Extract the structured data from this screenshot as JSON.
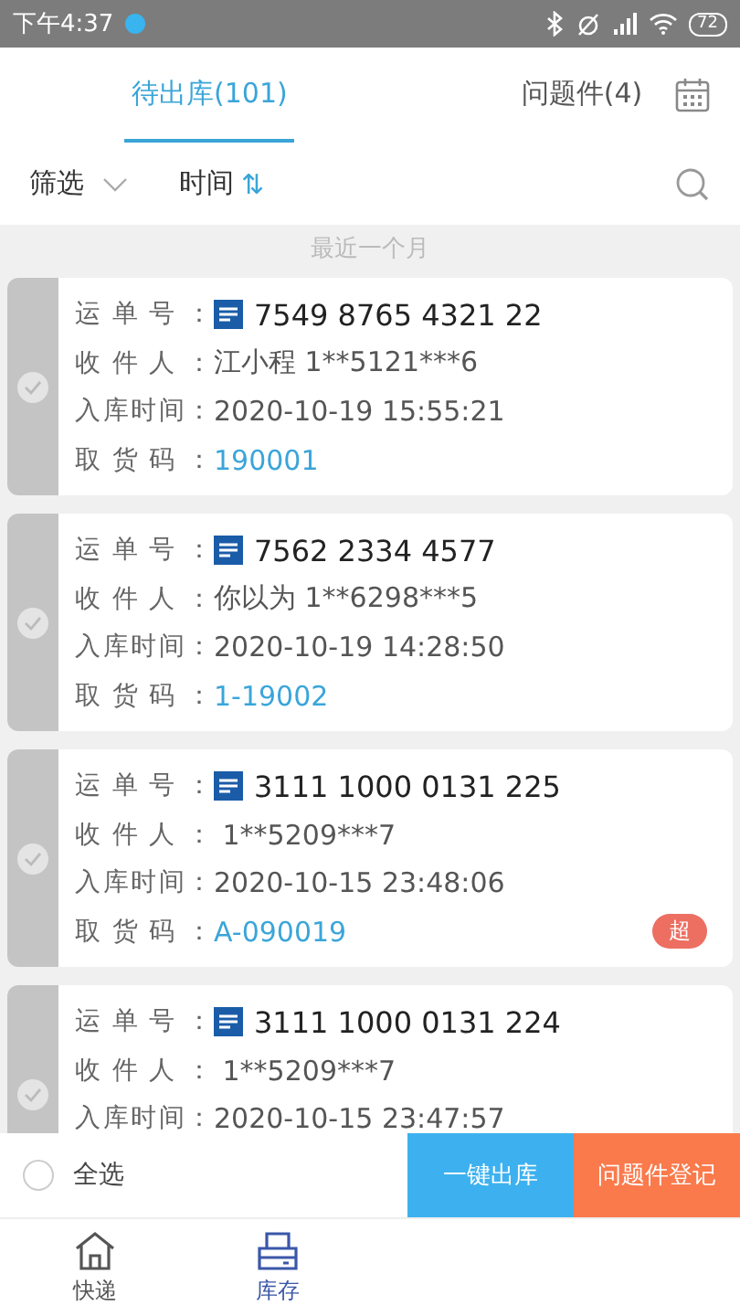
{
  "status_bar": {
    "time": "下午4:37",
    "battery": "72"
  },
  "tabs": [
    {
      "label": "待出库(101)",
      "selected": true
    },
    {
      "label": "问题件(4)",
      "selected": false
    }
  ],
  "filter_bar": {
    "filter": "筛选",
    "sort": "时间",
    "sort_icon": "⇅"
  },
  "section_label": "最近一个月",
  "parcels": [
    {
      "selected": false,
      "fields": [
        {
          "kind": "waybill",
          "label": "运单号：",
          "value": "7549 8765 4321 22"
        },
        {
          "kind": "recipient",
          "label": "收件人：",
          "value": "江小程 1**5121***6"
        },
        {
          "kind": "time",
          "label": "入库时间：",
          "value": "2020-10-19 15:55:21"
        },
        {
          "kind": "code",
          "label": "取货码：",
          "value": "190001"
        }
      ]
    },
    {
      "selected": false,
      "fields": [
        {
          "kind": "waybill",
          "label": "运单号：",
          "value": "7562 2334 4577"
        },
        {
          "kind": "recipient",
          "label": "收件人：",
          "value": "你以为 1**6298***5"
        },
        {
          "kind": "time",
          "label": "入库时间：",
          "value": "2020-10-19 14:28:50"
        },
        {
          "kind": "code",
          "label": "取货码：",
          "value": "1-19002"
        }
      ]
    },
    {
      "selected": false,
      "badge": "超",
      "fields": [
        {
          "kind": "waybill",
          "label": "运单号：",
          "value": "3111 1000 0131 225"
        },
        {
          "kind": "recipient",
          "label": "收件人：",
          "value": " 1**5209***7"
        },
        {
          "kind": "time",
          "label": "入库时间：",
          "value": "2020-10-15 23:48:06"
        },
        {
          "kind": "code",
          "label": "取货码：",
          "value": "A-090019"
        }
      ]
    },
    {
      "selected": false,
      "fields": [
        {
          "kind": "waybill",
          "label": "运单号：",
          "value": "3111 1000 0131 224"
        },
        {
          "kind": "recipient",
          "label": "收件人：",
          "value": " 1**5209***7"
        },
        {
          "kind": "time",
          "label": "入库时间：",
          "value": "2020-10-15 23:47:57"
        }
      ]
    }
  ],
  "action_bar": {
    "select_all": {
      "label": "全选",
      "selected": false
    },
    "buttons": [
      {
        "label": "一键出库",
        "kind": "primary"
      },
      {
        "label": "问题件登记",
        "kind": "warning"
      }
    ]
  },
  "bottom_nav": [
    {
      "label": "快递",
      "kind": "home",
      "selected": false
    },
    {
      "label": "库存",
      "kind": "printer",
      "selected": true
    }
  ]
}
